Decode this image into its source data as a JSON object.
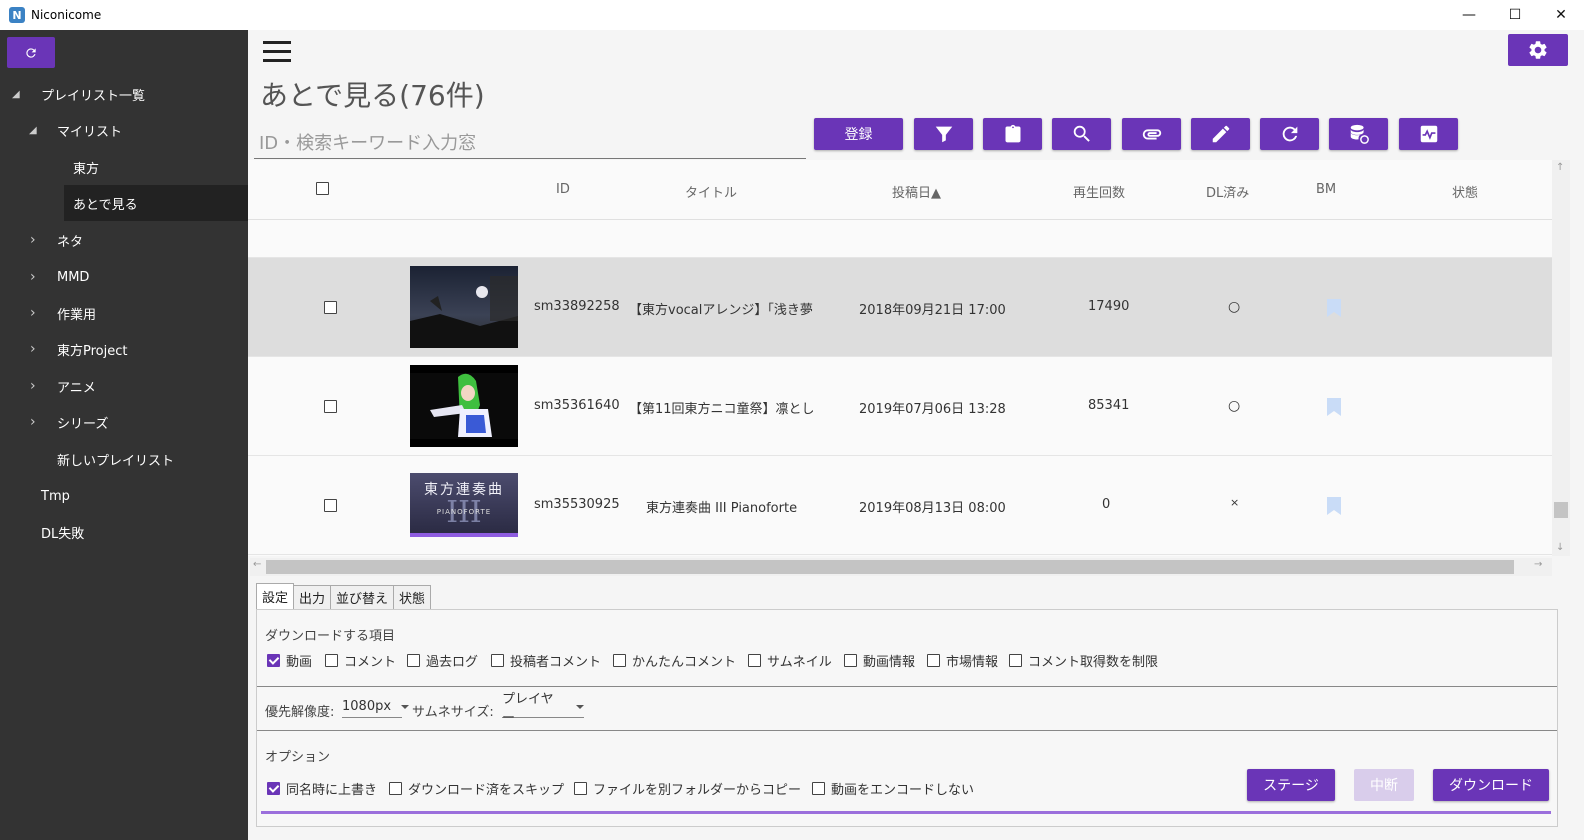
{
  "window": {
    "title": "Niconicome",
    "logo_letter": "N",
    "controls": {
      "minimize": "—",
      "maximize": "☐",
      "close": "✕"
    }
  },
  "sidebar": {
    "items": [
      {
        "label": "プレイリスト一覧",
        "arrow": "◢"
      },
      {
        "label": "マイリスト",
        "arrow": "◢"
      },
      {
        "label": "東方",
        "arrow": ""
      },
      {
        "label": "あとで見る",
        "arrow": ""
      },
      {
        "label": "ネタ",
        "arrow": "›"
      },
      {
        "label": "MMD",
        "arrow": "›"
      },
      {
        "label": "作業用",
        "arrow": "›"
      },
      {
        "label": "東方Project",
        "arrow": "›"
      },
      {
        "label": "アニメ",
        "arrow": "›"
      },
      {
        "label": "シリーズ",
        "arrow": "›"
      },
      {
        "label": "新しいプレイリスト",
        "arrow": ""
      },
      {
        "label": "Tmp",
        "arrow": ""
      },
      {
        "label": "DL失敗",
        "arrow": ""
      }
    ]
  },
  "main": {
    "title": "あとで見る(76件)",
    "search_placeholder": "ID・検索キーワード入力窓",
    "toolbar": {
      "register_label": "登録",
      "icons": [
        "filter-icon",
        "clipboard-icon",
        "search-icon",
        "attach-icon",
        "edit-icon",
        "refresh-icon",
        "database-sync-icon",
        "monitor-icon"
      ]
    }
  },
  "table": {
    "headers": {
      "id": "ID",
      "title": "タイトル",
      "posted": "投稿日▲",
      "views": "再生回数",
      "dl": "DL済み",
      "bm": "BM",
      "state": "状態"
    },
    "rows": [
      {
        "id": "sm33892258",
        "title": "【東方vocalアレンジ】「浅き夢.",
        "posted": "2018年09月21日 17:00",
        "views": "17490",
        "dl": "○",
        "thumb": "night-sky"
      },
      {
        "id": "sm35361640",
        "title": "【第11回東方ニコ童祭】凛としﾞ",
        "posted": "2019年07月06日 13:28",
        "views": "85341",
        "dl": "○",
        "thumb": "green-hair"
      },
      {
        "id": "sm35530925",
        "title": "東方連奏曲 III Pianoforte",
        "posted": "2019年08月13日 08:00",
        "views": "0",
        "dl": "×",
        "thumb": "title-card",
        "thumb_text": "東方連奏曲",
        "thumb_sub": "PIANOFORTE",
        "thumb_num": "III"
      }
    ]
  },
  "bottom": {
    "tabs": [
      "設定",
      "出力",
      "並び替え",
      "状態"
    ],
    "download_items_label": "ダウンロードする項目",
    "download_items": [
      {
        "label": "動画",
        "checked": true
      },
      {
        "label": "コメント",
        "checked": false
      },
      {
        "label": "過去ログ",
        "checked": false
      },
      {
        "label": "投稿者コメント",
        "checked": false
      },
      {
        "label": "かんたんコメント",
        "checked": false
      },
      {
        "label": "サムネイル",
        "checked": false
      },
      {
        "label": "動画情報",
        "checked": false
      },
      {
        "label": "市場情報",
        "checked": false
      },
      {
        "label": "コメント取得数を制限",
        "checked": false
      }
    ],
    "resolution_label": "優先解像度:",
    "resolution_value": "1080px",
    "thumb_size_label": "サムネサイズ:",
    "thumb_size_value": "プレイヤー",
    "options_label": "オプション",
    "options": [
      {
        "label": "同名時に上書き",
        "checked": true
      },
      {
        "label": "ダウンロード済をスキップ",
        "checked": false
      },
      {
        "label": "ファイルを別フォルダーからコピー",
        "checked": false
      },
      {
        "label": "動画をエンコードしない",
        "checked": false
      }
    ],
    "buttons": {
      "stage": "ステージ",
      "abort": "中断",
      "download": "ダウンロード"
    }
  },
  "colors": {
    "accent": "#6a35b7",
    "sidebar_bg": "#333333",
    "bookmark": "#c9dcf7"
  }
}
